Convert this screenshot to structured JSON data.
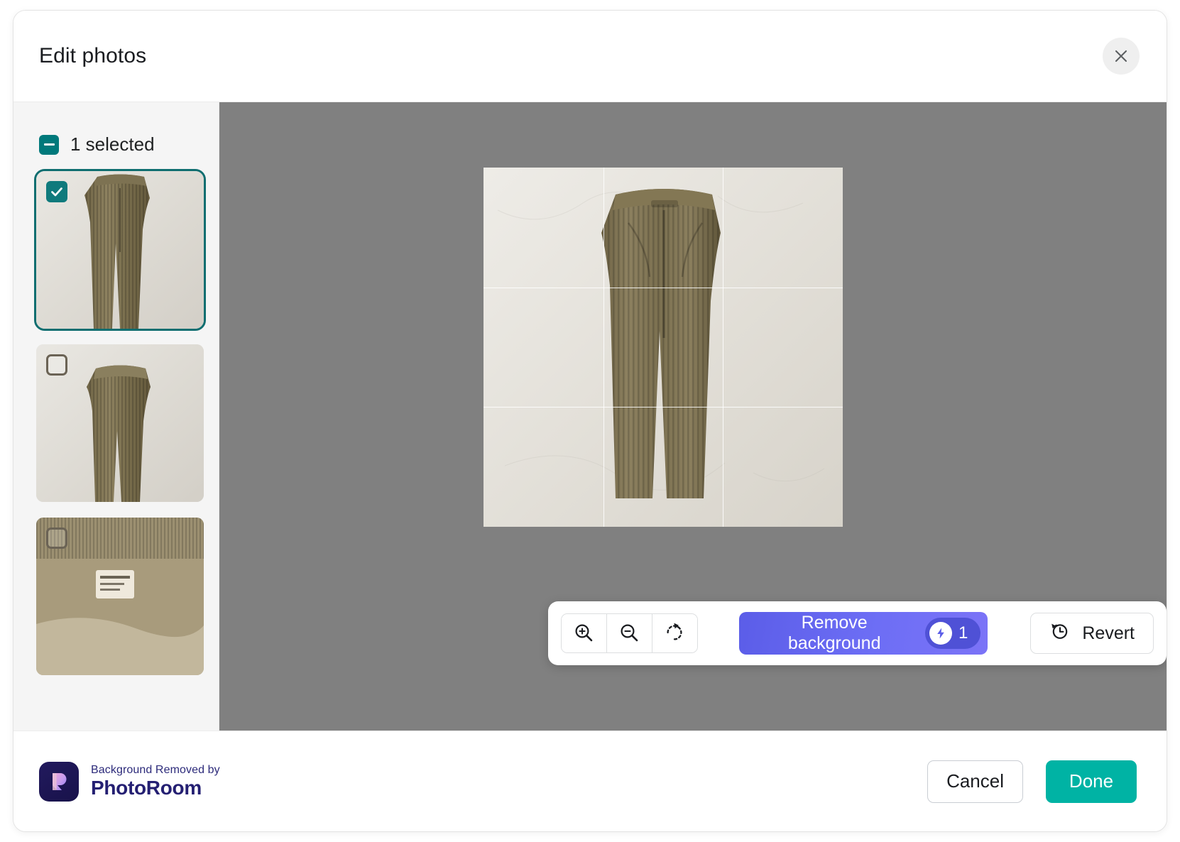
{
  "header": {
    "title": "Edit photos",
    "close_icon": "close-icon"
  },
  "sidebar": {
    "selection_label": "1 selected",
    "selection_state": "indeterminate",
    "thumbnails": [
      {
        "alt": "Corduroy pants flat lay full view",
        "selected": true,
        "checkbox_icon": "check-icon"
      },
      {
        "alt": "Corduroy pants waistband view",
        "selected": false,
        "checkbox_icon": "empty-checkbox-icon"
      },
      {
        "alt": "Corduroy pants interior label close-up",
        "selected": false,
        "checkbox_icon": "empty-checkbox-icon"
      }
    ]
  },
  "stage": {
    "photo_alt": "Olive corduroy trousers on light textured background",
    "grid_overlay": true
  },
  "toolbar": {
    "zoom_in_icon": "zoom-in-icon",
    "zoom_out_icon": "zoom-out-icon",
    "rotate_icon": "rotate-left-icon",
    "remove_background_label": "Remove background",
    "credit_icon": "lightning-bolt-icon",
    "credit_count": "1",
    "revert_label": "Revert",
    "revert_icon": "history-icon"
  },
  "footer": {
    "brand_top": "Background Removed by",
    "brand_bottom": "PhotoRoom",
    "brand_logo_icon": "photoroom-r-logo-icon",
    "cancel_label": "Cancel",
    "done_label": "Done"
  },
  "colors": {
    "teal_accent": "#00797b",
    "done_green": "#00b3a4",
    "purple_primary": "#6d6ef5",
    "purple_pill": "#4f51d6",
    "stage_gray": "#808080"
  }
}
